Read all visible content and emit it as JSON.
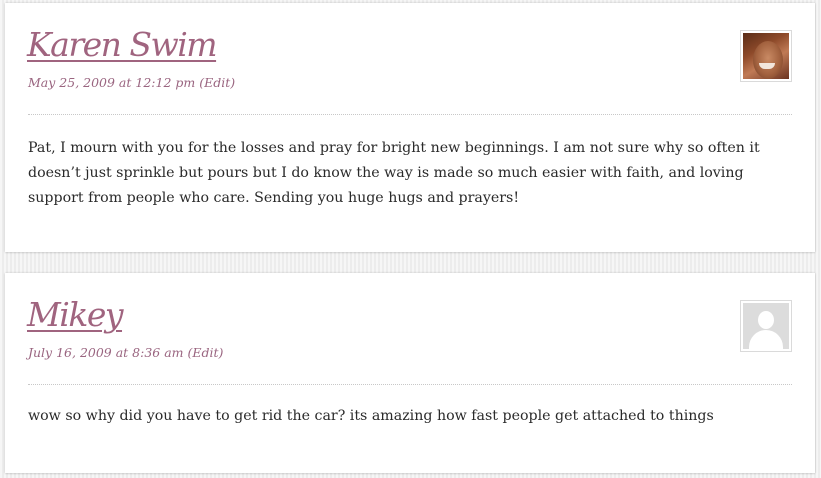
{
  "comments": [
    {
      "author": "Karen Swim",
      "date": "May 25, 2009 at 12:12 pm",
      "edit_label": "(Edit)",
      "avatar": "author-photo",
      "body": "Pat, I mourn with you for the losses and pray for bright new beginnings. I am not sure why so often it doesn’t just sprinkle but pours but I do know the way is made so much easier with faith, and loving support from people who care. Sending you huge hugs and prayers!"
    },
    {
      "author": "Mikey",
      "date": "July 16, 2009 at 8:36 am",
      "edit_label": "(Edit)",
      "avatar": "default-avatar-silhouette",
      "body": "wow so why did you have to get rid the car? its amazing how fast people get attached to things"
    }
  ],
  "colors": {
    "author_link": "#a0647f",
    "meta_text": "#9a6580",
    "body_text": "#2a2a2a",
    "card_background": "#ffffff",
    "page_background": "#ececec"
  }
}
